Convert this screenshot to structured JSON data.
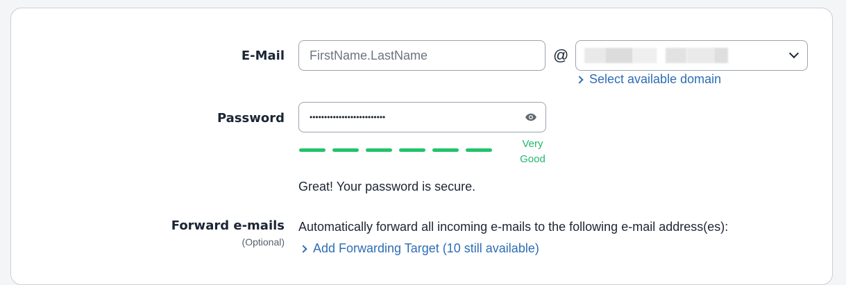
{
  "email": {
    "label": "E-Mail",
    "placeholder": "FirstName.LastName",
    "at_symbol": "@",
    "domain_select_value": "",
    "select_domain_link": "Select available domain"
  },
  "password": {
    "label": "Password",
    "masked_value": "••••••••••••••••••••••••••",
    "toggle_icon": "eye-icon",
    "strength_segments": 6,
    "strength_filled": 6,
    "strength_text": "Very Good",
    "strength_line1": "Very",
    "strength_line2": "Good",
    "strength_color": "#21c36b",
    "message": "Great! Your password is secure."
  },
  "forward": {
    "label": "Forward e-mails",
    "sublabel": "(Optional)",
    "description": "Automatically forward all incoming e-mails to the following e-mail address(es):",
    "add_link": "Add Forwarding Target (10 still available)"
  },
  "colors": {
    "link": "#2d6db5",
    "success": "#21c36b",
    "border": "#9aa3ae"
  }
}
